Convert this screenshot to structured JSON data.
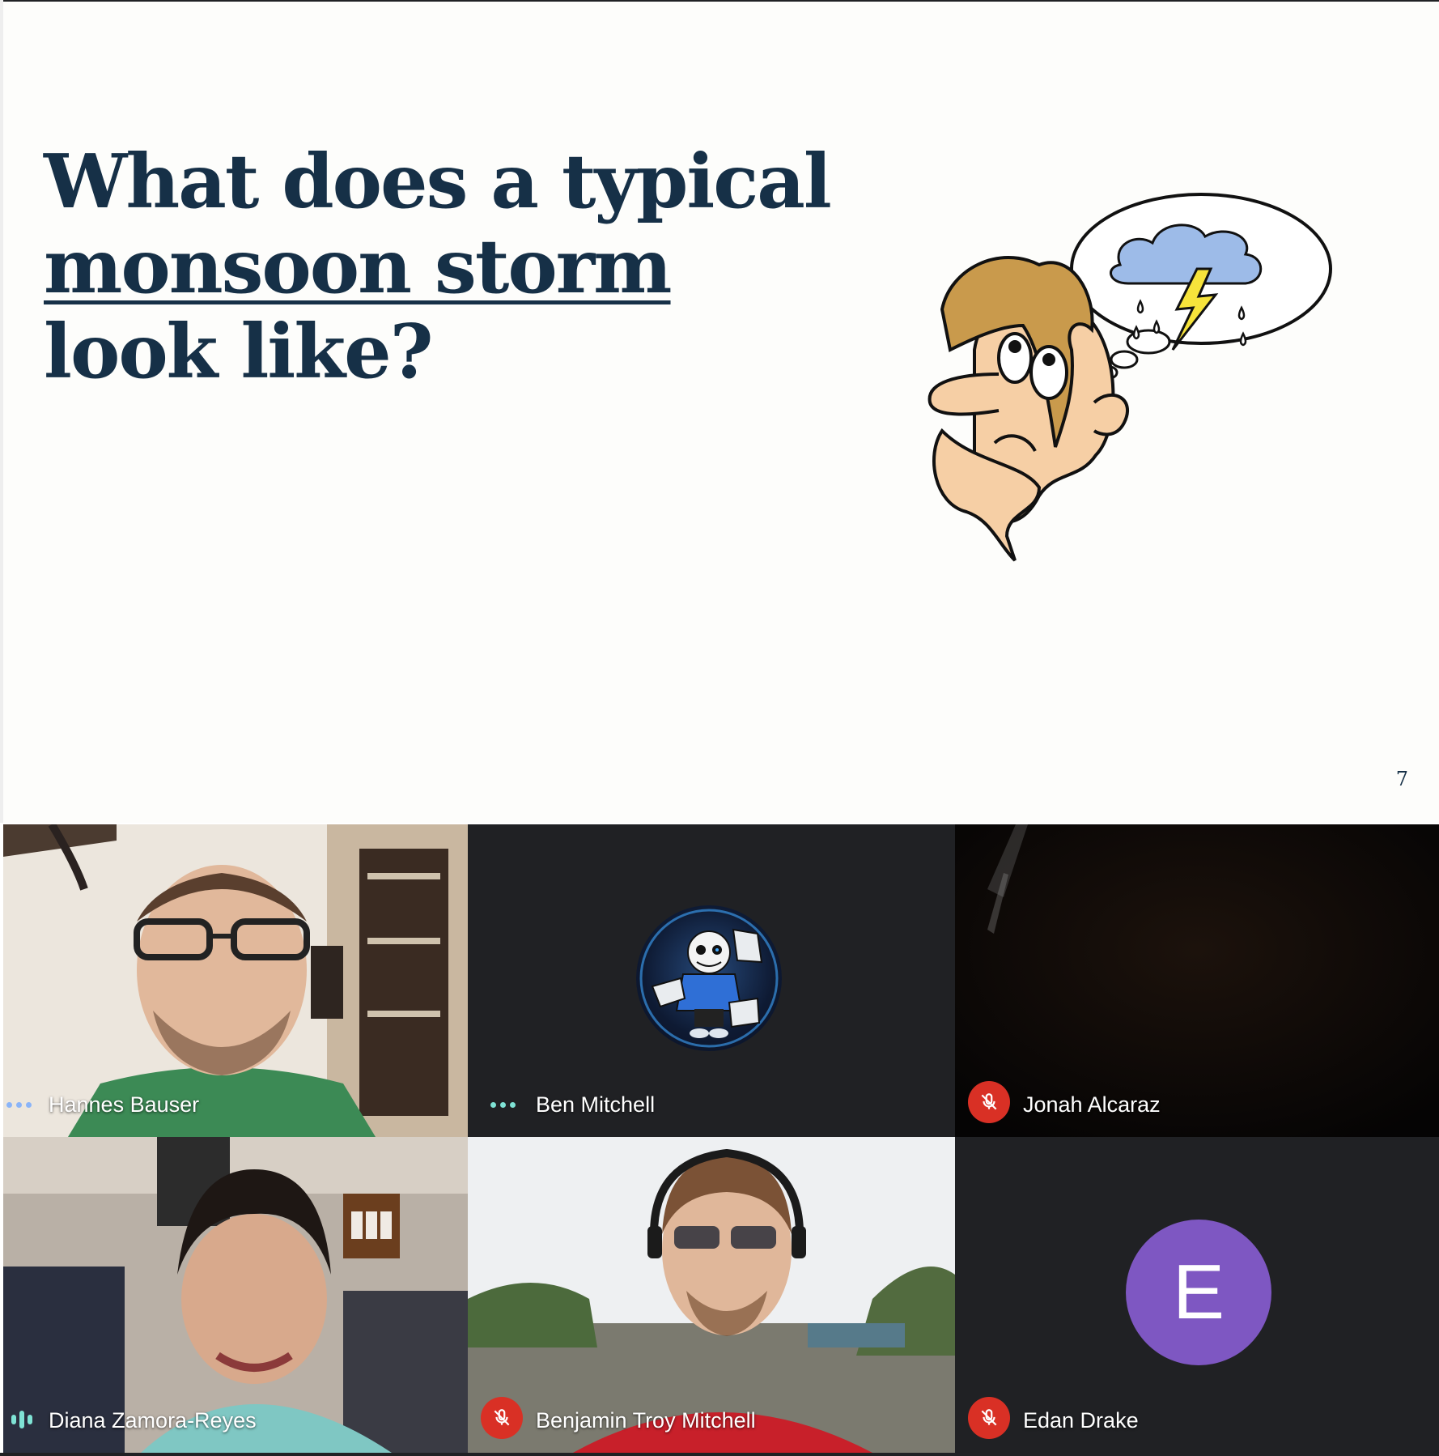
{
  "slide": {
    "title_before": "What does a typical",
    "title_underlined": "monsoon storm",
    "title_after": "look like?",
    "page_number": "7",
    "illustration": "thinking-man-storm-cloud-icon"
  },
  "participants": [
    {
      "name": "Hannes Bauser",
      "status": "more-options-dots",
      "video": "camera-on"
    },
    {
      "name": "Ben Mitchell",
      "status": "more-options-dots",
      "video": "profile-avatar"
    },
    {
      "name": "Jonah Alcaraz",
      "status": "muted",
      "video": "camera-dark"
    },
    {
      "name": "Diana Zamora-Reyes",
      "status": "speaking",
      "video": "camera-on"
    },
    {
      "name": "Benjamin Troy Mitchell",
      "status": "muted",
      "video": "camera-on"
    },
    {
      "name": "Edan Drake",
      "status": "muted",
      "video": "letter-avatar",
      "avatar_letter": "E"
    }
  ],
  "colors": {
    "title": "#163047",
    "tile_background": "#202124",
    "mute_red": "#d93025",
    "avatar_purple": "#7e57c2",
    "speaking_teal": "#7fe3d5"
  }
}
